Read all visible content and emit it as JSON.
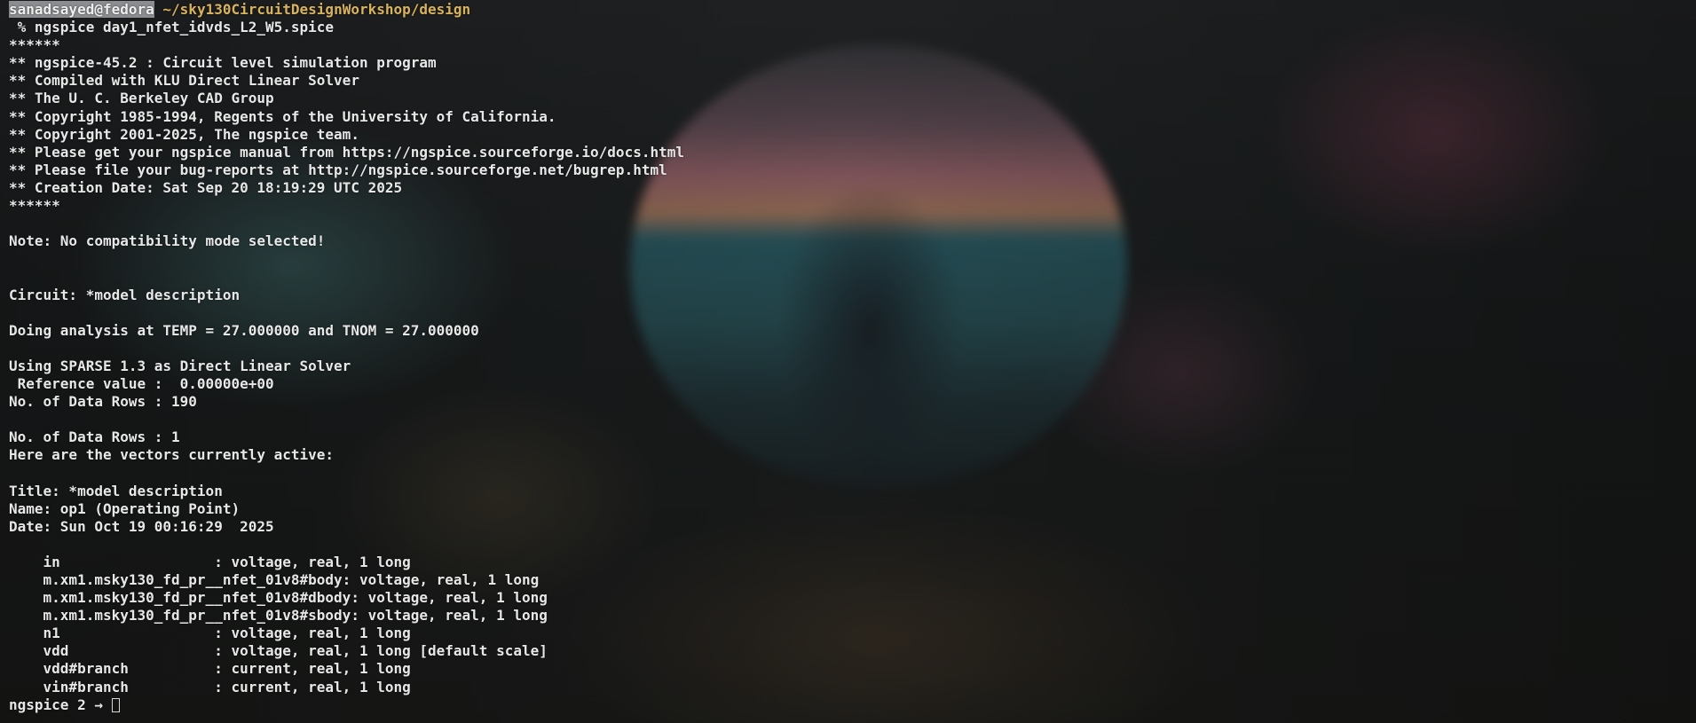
{
  "prompt": {
    "user": "sanadsayed@fedora",
    "path": "~/sky130CircuitDesignWorkshop/design",
    "command": " % ngspice day1_nfet_idvds_L2_W5.spice"
  },
  "banner": [
    "******",
    "** ngspice-45.2 : Circuit level simulation program",
    "** Compiled with KLU Direct Linear Solver",
    "** The U. C. Berkeley CAD Group",
    "** Copyright 1985-1994, Regents of the University of California.",
    "** Copyright 2001-2025, The ngspice team.",
    "** Please get your ngspice manual from https://ngspice.sourceforge.io/docs.html",
    "** Please file your bug-reports at http://ngspice.sourceforge.net/bugrep.html",
    "** Creation Date: Sat Sep 20 18:19:29 UTC 2025",
    "******"
  ],
  "note": "Note: No compatibility mode selected!",
  "circuit": "Circuit: *model description",
  "analysis": "Doing analysis at TEMP = 27.000000 and TNOM = 27.000000",
  "solver": "Using SPARSE 1.3 as Direct Linear Solver",
  "reference": " Reference value :  0.00000e+00",
  "rows1": "No. of Data Rows : 190",
  "rows2": "No. of Data Rows : 1",
  "vectors_header": "Here are the vectors currently active:",
  "title": "Title: *model description",
  "name": "Name: op1 (Operating Point)",
  "date": "Date: Sun Oct 19 00:16:29  2025",
  "vectors": [
    "    in                  : voltage, real, 1 long",
    "    m.xm1.msky130_fd_pr__nfet_01v8#body: voltage, real, 1 long",
    "    m.xm1.msky130_fd_pr__nfet_01v8#dbody: voltage, real, 1 long",
    "    m.xm1.msky130_fd_pr__nfet_01v8#sbody: voltage, real, 1 long",
    "    n1                  : voltage, real, 1 long",
    "    vdd                 : voltage, real, 1 long [default scale]",
    "    vdd#branch          : current, real, 1 long",
    "    vin#branch          : current, real, 1 long"
  ],
  "final_prompt": "ngspice 2 → "
}
